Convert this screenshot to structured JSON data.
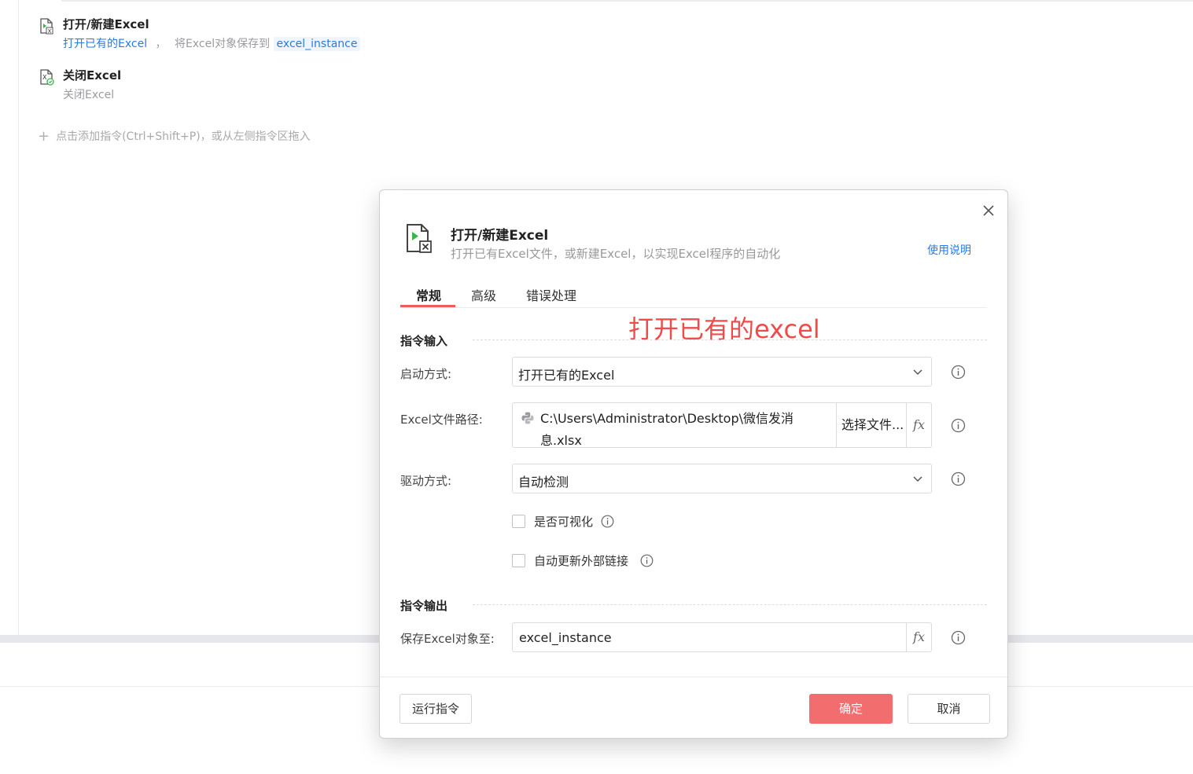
{
  "flow": {
    "steps": [
      {
        "title": "打开/新建Excel",
        "desc_action": "打开已有的Excel",
        "desc_sep": "，",
        "desc_mid": "将Excel对象保存到",
        "desc_var": "excel_instance",
        "icon": "excel-open-icon"
      },
      {
        "title": "关闭Excel",
        "desc": "关闭Excel",
        "icon": "excel-close-icon"
      }
    ],
    "add_hint": "点击添加指令(Ctrl+Shift+P)，或从左侧指令区拖入"
  },
  "dialog": {
    "title": "打开/新建Excel",
    "subtitle": "打开已有Excel文件，或新建Excel，以实现Excel程序的自动化",
    "help_link": "使用说明",
    "tabs": [
      "常规",
      "高级",
      "错误处理"
    ],
    "active_tab": 0,
    "annotation": "打开已有的excel",
    "input_section": "指令输入",
    "output_section": "指令输出",
    "fields": {
      "launch_mode": {
        "label": "启动方式:",
        "value": "打开已有的Excel"
      },
      "file_path": {
        "label": "Excel文件路径:",
        "value_line1": "C:\\Users\\Administrator\\Desktop\\微信发消",
        "value_line2": "息.xlsx",
        "pick_button": "选择文件...",
        "fx": "fx"
      },
      "driver": {
        "label": "驱动方式:",
        "value": "自动检测"
      },
      "visible": {
        "label": "是否可视化",
        "checked": false
      },
      "auto_update_links": {
        "label": "自动更新外部链接",
        "checked": false
      },
      "save_to": {
        "label": "保存Excel对象至:",
        "value": "excel_instance",
        "fx": "fx"
      }
    },
    "buttons": {
      "run": "运行指令",
      "ok": "确定",
      "cancel": "取消"
    },
    "colors": {
      "accent": "#f26d6d",
      "link": "#2a7ae4",
      "annotation": "#ef4b4b"
    }
  }
}
